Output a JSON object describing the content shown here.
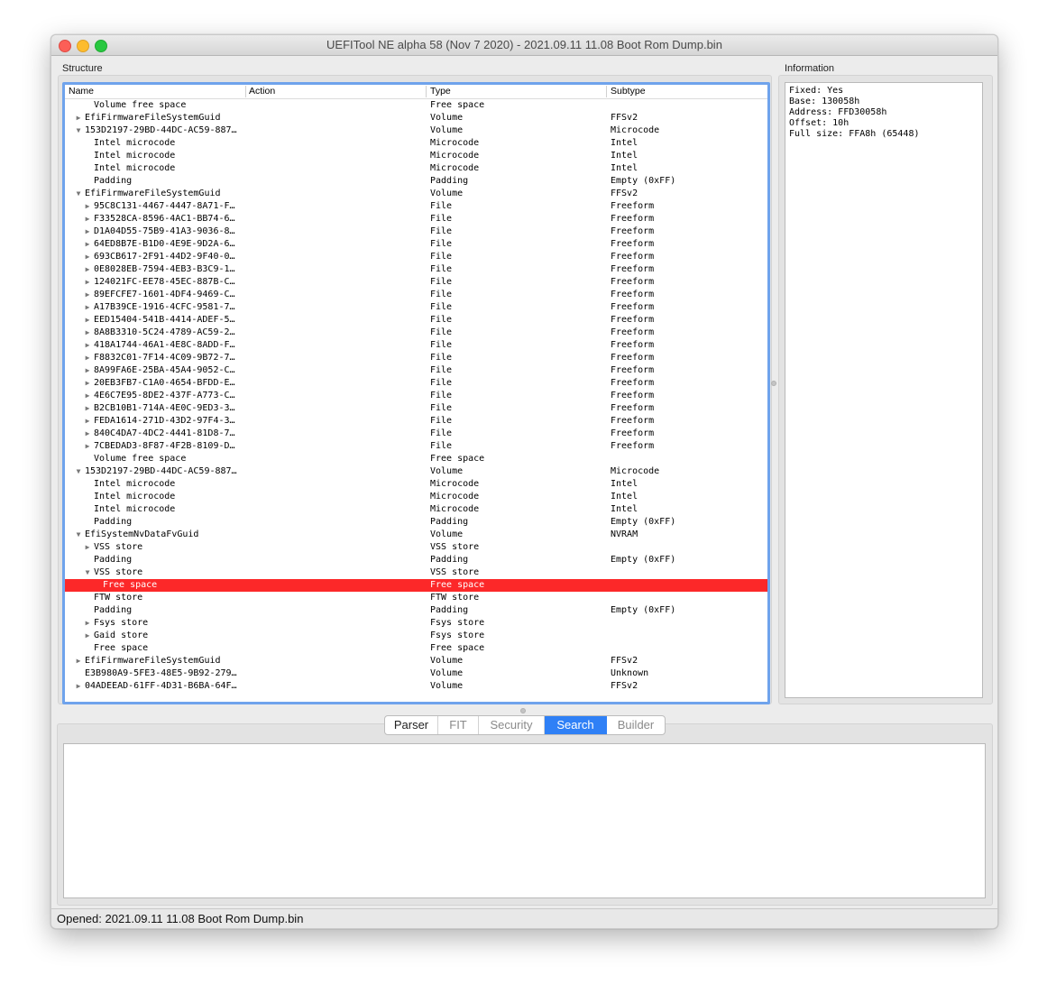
{
  "window": {
    "title": "UEFITool NE alpha 58 (Nov  7 2020) - 2021.09.11 11.08 Boot Rom Dump.bin"
  },
  "labels": {
    "structure": "Structure",
    "information": "Information"
  },
  "tree": {
    "columns": [
      "Name",
      "Action",
      "Type",
      "Subtype"
    ],
    "rows": [
      {
        "indent": 2,
        "arrow": "",
        "name": "Volume free space",
        "type": "Free space",
        "subtype": ""
      },
      {
        "indent": 1,
        "arrow": "▶",
        "name": "EfiFirmwareFileSystemGuid",
        "type": "Volume",
        "subtype": "FFSv2"
      },
      {
        "indent": 1,
        "arrow": "▼",
        "name": "153D2197-29BD-44DC-AC59-887…",
        "type": "Volume",
        "subtype": "Microcode"
      },
      {
        "indent": 2,
        "arrow": "",
        "name": "Intel microcode",
        "type": "Microcode",
        "subtype": "Intel"
      },
      {
        "indent": 2,
        "arrow": "",
        "name": "Intel microcode",
        "type": "Microcode",
        "subtype": "Intel"
      },
      {
        "indent": 2,
        "arrow": "",
        "name": "Intel microcode",
        "type": "Microcode",
        "subtype": "Intel"
      },
      {
        "indent": 2,
        "arrow": "",
        "name": "Padding",
        "type": "Padding",
        "subtype": "Empty (0xFF)"
      },
      {
        "indent": 1,
        "arrow": "▼",
        "name": "EfiFirmwareFileSystemGuid",
        "type": "Volume",
        "subtype": "FFSv2"
      },
      {
        "indent": 2,
        "arrow": "▶",
        "name": "95C8C131-4467-4447-8A71-F…",
        "type": "File",
        "subtype": "Freeform"
      },
      {
        "indent": 2,
        "arrow": "▶",
        "name": "F33528CA-8596-4AC1-BB74-6…",
        "type": "File",
        "subtype": "Freeform"
      },
      {
        "indent": 2,
        "arrow": "▶",
        "name": "D1A04D55-75B9-41A3-9036-8…",
        "type": "File",
        "subtype": "Freeform"
      },
      {
        "indent": 2,
        "arrow": "▶",
        "name": "64ED8B7E-B1D0-4E9E-9D2A-6…",
        "type": "File",
        "subtype": "Freeform"
      },
      {
        "indent": 2,
        "arrow": "▶",
        "name": "693CB617-2F91-44D2-9F40-0…",
        "type": "File",
        "subtype": "Freeform"
      },
      {
        "indent": 2,
        "arrow": "▶",
        "name": "0E8028EB-7594-4EB3-B3C9-1…",
        "type": "File",
        "subtype": "Freeform"
      },
      {
        "indent": 2,
        "arrow": "▶",
        "name": "124021FC-EE78-45EC-887B-C…",
        "type": "File",
        "subtype": "Freeform"
      },
      {
        "indent": 2,
        "arrow": "▶",
        "name": "89EFCFE7-1601-4DF4-9469-C…",
        "type": "File",
        "subtype": "Freeform"
      },
      {
        "indent": 2,
        "arrow": "▶",
        "name": "A17B39CE-1916-4CFC-9581-7…",
        "type": "File",
        "subtype": "Freeform"
      },
      {
        "indent": 2,
        "arrow": "▶",
        "name": "EED15404-541B-4414-ADEF-5…",
        "type": "File",
        "subtype": "Freeform"
      },
      {
        "indent": 2,
        "arrow": "▶",
        "name": "8A8B3310-5C24-4789-AC59-2…",
        "type": "File",
        "subtype": "Freeform"
      },
      {
        "indent": 2,
        "arrow": "▶",
        "name": "418A1744-46A1-4E8C-8ADD-F…",
        "type": "File",
        "subtype": "Freeform"
      },
      {
        "indent": 2,
        "arrow": "▶",
        "name": "F8832C01-7F14-4C09-9B72-7…",
        "type": "File",
        "subtype": "Freeform"
      },
      {
        "indent": 2,
        "arrow": "▶",
        "name": "8A99FA6E-25BA-45A4-9052-C…",
        "type": "File",
        "subtype": "Freeform"
      },
      {
        "indent": 2,
        "arrow": "▶",
        "name": "20EB3FB7-C1A0-4654-BFDD-E…",
        "type": "File",
        "subtype": "Freeform"
      },
      {
        "indent": 2,
        "arrow": "▶",
        "name": "4E6C7E95-8DE2-437F-A773-C…",
        "type": "File",
        "subtype": "Freeform"
      },
      {
        "indent": 2,
        "arrow": "▶",
        "name": "B2CB10B1-714A-4E0C-9ED3-3…",
        "type": "File",
        "subtype": "Freeform"
      },
      {
        "indent": 2,
        "arrow": "▶",
        "name": "FEDA1614-271D-43D2-97F4-3…",
        "type": "File",
        "subtype": "Freeform"
      },
      {
        "indent": 2,
        "arrow": "▶",
        "name": "840C4DA7-4DC2-4441-81D8-7…",
        "type": "File",
        "subtype": "Freeform"
      },
      {
        "indent": 2,
        "arrow": "▶",
        "name": "7CBEDAD3-8F87-4F2B-8109-D…",
        "type": "File",
        "subtype": "Freeform"
      },
      {
        "indent": 2,
        "arrow": "",
        "name": "Volume free space",
        "type": "Free space",
        "subtype": ""
      },
      {
        "indent": 1,
        "arrow": "▼",
        "name": "153D2197-29BD-44DC-AC59-887…",
        "type": "Volume",
        "subtype": "Microcode"
      },
      {
        "indent": 2,
        "arrow": "",
        "name": "Intel microcode",
        "type": "Microcode",
        "subtype": "Intel"
      },
      {
        "indent": 2,
        "arrow": "",
        "name": "Intel microcode",
        "type": "Microcode",
        "subtype": "Intel"
      },
      {
        "indent": 2,
        "arrow": "",
        "name": "Intel microcode",
        "type": "Microcode",
        "subtype": "Intel"
      },
      {
        "indent": 2,
        "arrow": "",
        "name": "Padding",
        "type": "Padding",
        "subtype": "Empty (0xFF)"
      },
      {
        "indent": 1,
        "arrow": "▼",
        "name": "EfiSystemNvDataFvGuid",
        "type": "Volume",
        "subtype": "NVRAM"
      },
      {
        "indent": 2,
        "arrow": "▶",
        "name": "VSS store",
        "type": "VSS store",
        "subtype": ""
      },
      {
        "indent": 2,
        "arrow": "",
        "name": "Padding",
        "type": "Padding",
        "subtype": "Empty (0xFF)"
      },
      {
        "indent": 2,
        "arrow": "▼",
        "name": "VSS store",
        "type": "VSS store",
        "subtype": ""
      },
      {
        "indent": 3,
        "arrow": "",
        "name": "Free space",
        "type": "Free space",
        "subtype": "",
        "selected": true
      },
      {
        "indent": 2,
        "arrow": "",
        "name": "FTW store",
        "type": "FTW store",
        "subtype": ""
      },
      {
        "indent": 2,
        "arrow": "",
        "name": "Padding",
        "type": "Padding",
        "subtype": "Empty (0xFF)"
      },
      {
        "indent": 2,
        "arrow": "▶",
        "name": "Fsys store",
        "type": "Fsys store",
        "subtype": ""
      },
      {
        "indent": 2,
        "arrow": "▶",
        "name": "Gaid store",
        "type": "Fsys store",
        "subtype": ""
      },
      {
        "indent": 2,
        "arrow": "",
        "name": "Free space",
        "type": "Free space",
        "subtype": ""
      },
      {
        "indent": 1,
        "arrow": "▶",
        "name": "EfiFirmwareFileSystemGuid",
        "type": "Volume",
        "subtype": "FFSv2"
      },
      {
        "indent": 1,
        "arrow": "",
        "name": "E3B980A9-5FE3-48E5-9B92-279…",
        "type": "Volume",
        "subtype": "Unknown"
      },
      {
        "indent": 1,
        "arrow": "▶",
        "name": "04ADEEAD-61FF-4D31-B6BA-64F…",
        "type": "Volume",
        "subtype": "FFSv2"
      }
    ]
  },
  "information": {
    "lines": [
      "Fixed: Yes",
      "Base: 130058h",
      "Address: FFD30058h",
      "Offset: 10h",
      "Full size: FFA8h (65448)"
    ]
  },
  "tabs": [
    {
      "label": "Parser",
      "state": "normal"
    },
    {
      "label": "FIT",
      "state": "disabled"
    },
    {
      "label": "Security",
      "state": "disabled"
    },
    {
      "label": "Search",
      "state": "active"
    },
    {
      "label": "Builder",
      "state": "disabled"
    }
  ],
  "status": {
    "text": "Opened: 2021.09.11 11.08 Boot Rom Dump.bin"
  },
  "colors": {
    "selection": "#fc2829",
    "tab_active": "#2f80f6",
    "focus_ring": "#6fa3ec"
  }
}
